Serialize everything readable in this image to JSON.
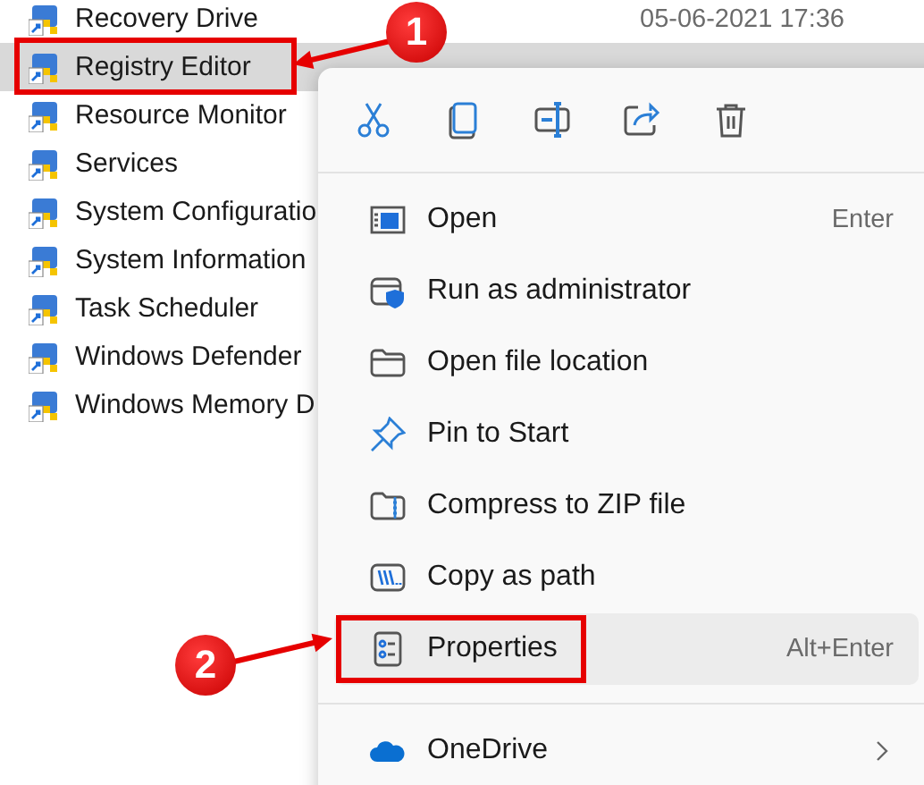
{
  "files": [
    {
      "name": "Recovery Drive",
      "date": "05-06-2021 17:36",
      "selected": false
    },
    {
      "name": "Registry Editor",
      "selected": true
    },
    {
      "name": "Resource Monitor",
      "selected": false
    },
    {
      "name": "Services",
      "selected": false
    },
    {
      "name": "System Configuratio",
      "selected": false
    },
    {
      "name": "System Information",
      "selected": false
    },
    {
      "name": "Task Scheduler",
      "selected": false
    },
    {
      "name": "Windows Defender",
      "selected": false
    },
    {
      "name": "Windows Memory D",
      "selected": false
    }
  ],
  "context_menu": {
    "toolbar": [
      {
        "kind": "cut"
      },
      {
        "kind": "copy"
      },
      {
        "kind": "rename"
      },
      {
        "kind": "share"
      },
      {
        "kind": "delete"
      }
    ],
    "items": [
      {
        "kind": "open",
        "label": "Open",
        "shortcut": "Enter",
        "selected": false
      },
      {
        "kind": "admin",
        "label": "Run as administrator",
        "selected": false
      },
      {
        "kind": "folder",
        "label": "Open file location",
        "selected": false
      },
      {
        "kind": "pin",
        "label": "Pin to Start",
        "selected": false
      },
      {
        "kind": "zip",
        "label": "Compress to ZIP file",
        "selected": false
      },
      {
        "kind": "path",
        "label": "Copy as path",
        "selected": false
      },
      {
        "kind": "properties",
        "label": "Properties",
        "shortcut": "Alt+Enter",
        "selected": true
      },
      {
        "kind": "divider"
      },
      {
        "kind": "cloud",
        "label": "OneDrive",
        "submenu": true,
        "selected": false
      }
    ]
  },
  "annotations": [
    {
      "number": "1"
    },
    {
      "number": "2"
    }
  ]
}
